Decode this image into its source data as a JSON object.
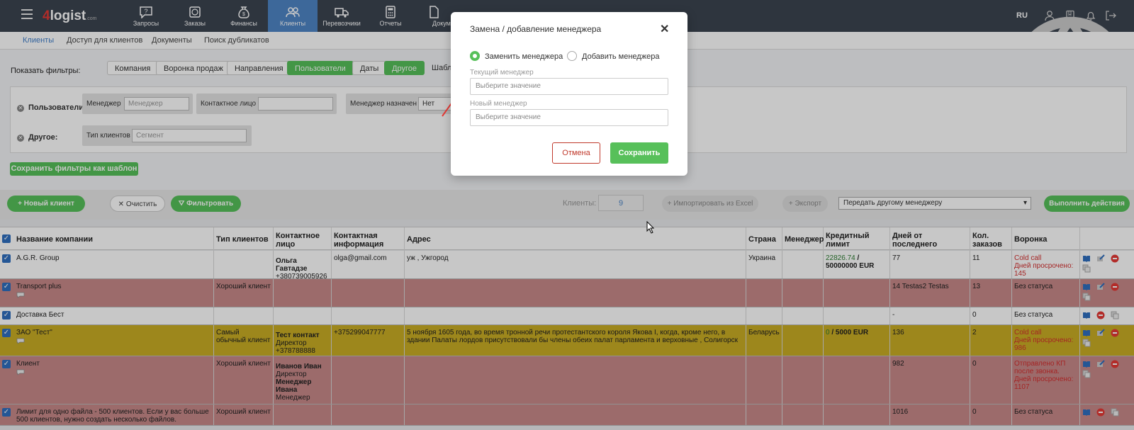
{
  "topnav": {
    "logo_num": "4",
    "logo_text": "logist",
    "logo_suffix": ".com",
    "items": [
      {
        "label": "Запросы",
        "icon": "chat-question-icon"
      },
      {
        "label": "Заказы",
        "icon": "globe-package-icon"
      },
      {
        "label": "Финансы",
        "icon": "money-bag-icon"
      },
      {
        "label": "Клиенты",
        "icon": "users-icon"
      },
      {
        "label": "Перевозчики",
        "icon": "truck-icon"
      },
      {
        "label": "Отчеты",
        "icon": "calculator-icon"
      },
      {
        "label": "Докум",
        "icon": "document-icon"
      }
    ],
    "lang": "RU"
  },
  "subnav": {
    "items": [
      "Клиенты",
      "Доступ для клиентов",
      "Документы",
      "Поиск дубликатов"
    ]
  },
  "filters": {
    "show_label": "Показать фильтры:",
    "chips": [
      "Компания",
      "Воронка продаж",
      "Направления",
      "Пользователи",
      "Даты",
      "Другое",
      "Шабло"
    ],
    "users_row_label": "Пользователи:",
    "manager_label": "Менеджер",
    "manager_placeholder": "Менеджер",
    "contact_label": "Контактное лицо",
    "manager_assigned_label": "Менеджер назначен",
    "manager_assigned_value": "Нет",
    "other_row_label": "Другое:",
    "client_type_label": "Тип клиентов",
    "segment_placeholder": "Сегмент",
    "save_template": "Сохранить фильтры как шаблон"
  },
  "actions": {
    "new_client": "Новый клиент",
    "clear": "Очистить",
    "filter": "Фильтровать",
    "clients_label": "Клиенты:",
    "clients_count": "9",
    "import_excel": "Импортировать из Excel",
    "export": "Экспорт",
    "transfer_select": "Передать другому менеджеру",
    "execute": "Выполнить действия"
  },
  "table": {
    "headers": [
      "Название компании",
      "Тип клиентов",
      "Контактное лицо",
      "Контактная информация",
      "Адрес",
      "Страна",
      "Менеджер",
      "Кредитный лимит",
      "Дней от последнего контакта",
      "Кол. заказов",
      "Воронка продаж"
    ],
    "rows": [
      {
        "name": "A.G.R. Group",
        "type": "",
        "contact_name": "Ольга Гавтадзе",
        "contact_extra": "+380739005926",
        "info": "olga@gmail.com",
        "address": "уж , Ужгород",
        "country": "Украина",
        "credit_a": "22826.74",
        "credit_b": "/ 50000000 EUR",
        "days": "77",
        "orders": "11",
        "funnel": "Cold call",
        "funnel_extra": "Дней просрочено: 145"
      },
      {
        "name": "Transport plus",
        "type": "Хороший клиент",
        "contact_name": "",
        "contact_extra": "",
        "info": "",
        "address": "",
        "country": "",
        "credit_a": "",
        "credit_b": "",
        "days": "14 Testas2 Testas",
        "orders": "13",
        "funnel": "Без статуса",
        "funnel_extra": ""
      },
      {
        "name": "Доставка Бест",
        "type": "",
        "contact_name": "",
        "contact_extra": "",
        "info": "",
        "address": "",
        "country": "",
        "credit_a": "",
        "credit_b": "",
        "days": "-",
        "orders": "0",
        "funnel": "Без статуса",
        "funnel_extra": ""
      },
      {
        "name": "ЗАО \"Тест\"",
        "type": "Самый обычный клиент",
        "contact_name": "Тест контакт",
        "contact_extra": "Директор +378788888",
        "info": "+375299047777",
        "address": "5 ноября 1605 года, во время тронной речи протестантского короля Якова I, когда, кроме него, в здании Палаты лордов присутствовали бы члены обеих палат парламента и верховные , Солигорск",
        "country": "Беларусь",
        "credit_a": "0",
        "credit_b": "/ 5000 EUR",
        "days": "136",
        "orders": "2",
        "funnel": "Cold call",
        "funnel_extra": "Дней просрочено: 986"
      },
      {
        "name": "Клиент",
        "type": "Хороший клиент",
        "contact_name": "Иванов Иван",
        "contact_extra": "Директор",
        "contact_name2": "Менеджер Ивана",
        "contact_extra2": "Менеджер",
        "info": "",
        "address": "",
        "country": "",
        "credit_a": "",
        "credit_b": "",
        "days": "982",
        "orders": "0",
        "funnel": "Отправлено КП после звонка.",
        "funnel_extra": "Дней просрочено: 1107"
      },
      {
        "name": "Лимит для одно файла - 500 клиентов. Если у вас больше 500 клиентов, нужно создать несколько файлов.",
        "type": "Хороший клиент",
        "contact_name": "",
        "contact_extra": "",
        "info": "",
        "address": "",
        "country": "",
        "credit_a": "",
        "credit_b": "",
        "days": "1016",
        "orders": "0",
        "funnel": "Без статуса",
        "funnel_extra": ""
      }
    ]
  },
  "modal": {
    "title": "Замена / добавление менеджера",
    "radio_replace": "Заменить менеджера",
    "radio_add": "Добавить менеджера",
    "current_label": "Текущий менеджер",
    "current_placeholder": "Выберите значение",
    "new_label": "Новый менеджер",
    "new_placeholder": "Выберите значение",
    "cancel": "Отмена",
    "save": "Сохранить"
  },
  "colors": {
    "nav_bg": "#3c4450",
    "nav_active": "#4f86c6",
    "green": "#57c05a",
    "row_pink": "#c88a8a",
    "row_yellow": "#c9ad24",
    "danger": "#c0392b"
  }
}
